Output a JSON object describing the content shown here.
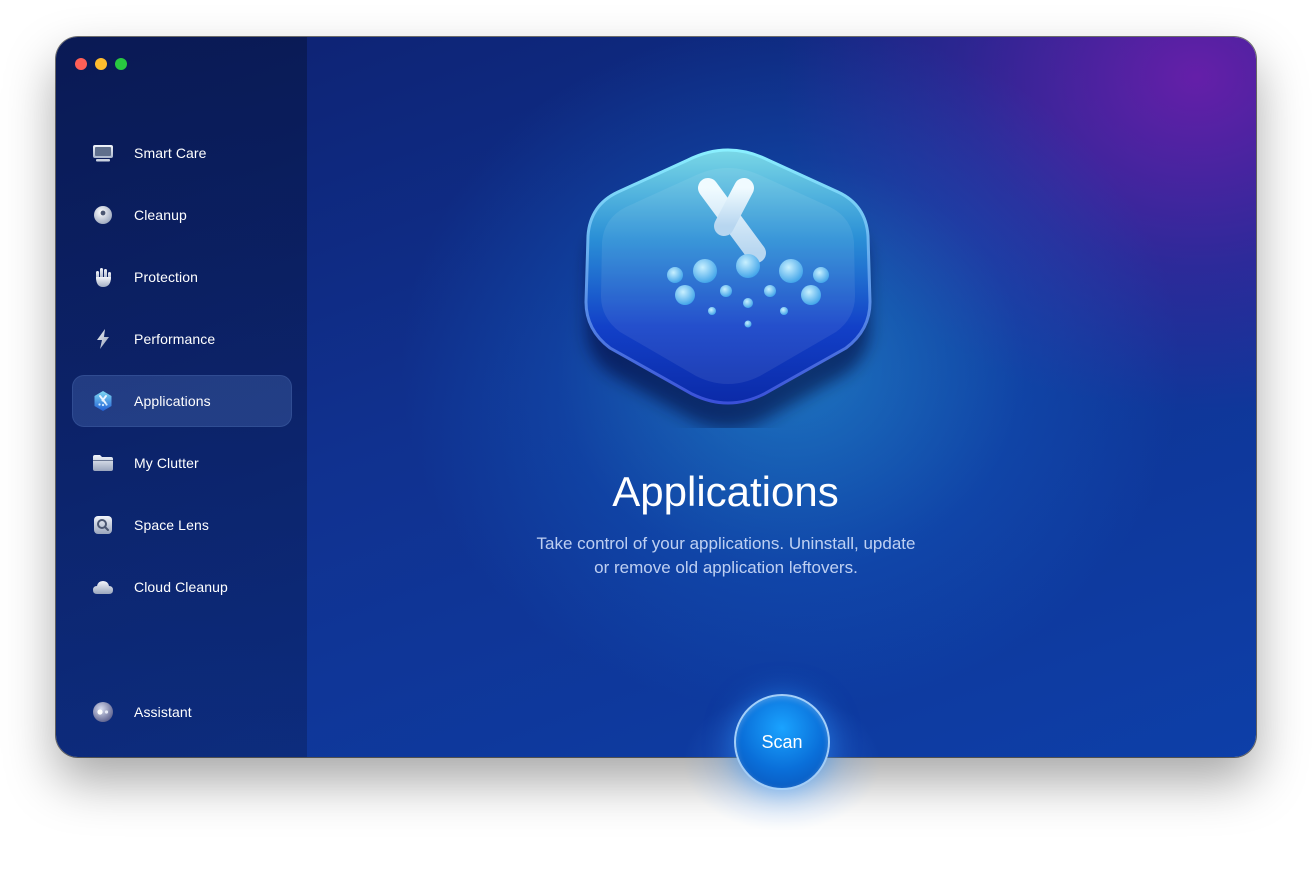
{
  "sidebar": {
    "items": [
      {
        "label": "Smart Care",
        "icon": "display-icon",
        "active": false
      },
      {
        "label": "Cleanup",
        "icon": "cleanup-sphere-icon",
        "active": false
      },
      {
        "label": "Protection",
        "icon": "hand-icon",
        "active": false
      },
      {
        "label": "Performance",
        "icon": "lightning-icon",
        "active": false
      },
      {
        "label": "Applications",
        "icon": "applications-icon",
        "active": true
      },
      {
        "label": "My Clutter",
        "icon": "folder-icon",
        "active": false
      },
      {
        "label": "Space Lens",
        "icon": "lens-icon",
        "active": false
      },
      {
        "label": "Cloud Cleanup",
        "icon": "cloud-icon",
        "active": false
      }
    ],
    "assistant": {
      "label": "Assistant",
      "icon": "assistant-icon"
    }
  },
  "main": {
    "title": "Applications",
    "description_line1": "Take control of your applications. Uninstall, update",
    "description_line2": "or remove old application leftovers.",
    "scan_label": "Scan",
    "hero_icon": "applications-hero-icon"
  },
  "colors": {
    "close": "#fe5f57",
    "minimize": "#febc2e",
    "zoom": "#28c840",
    "accent": "#1aa3ff"
  }
}
